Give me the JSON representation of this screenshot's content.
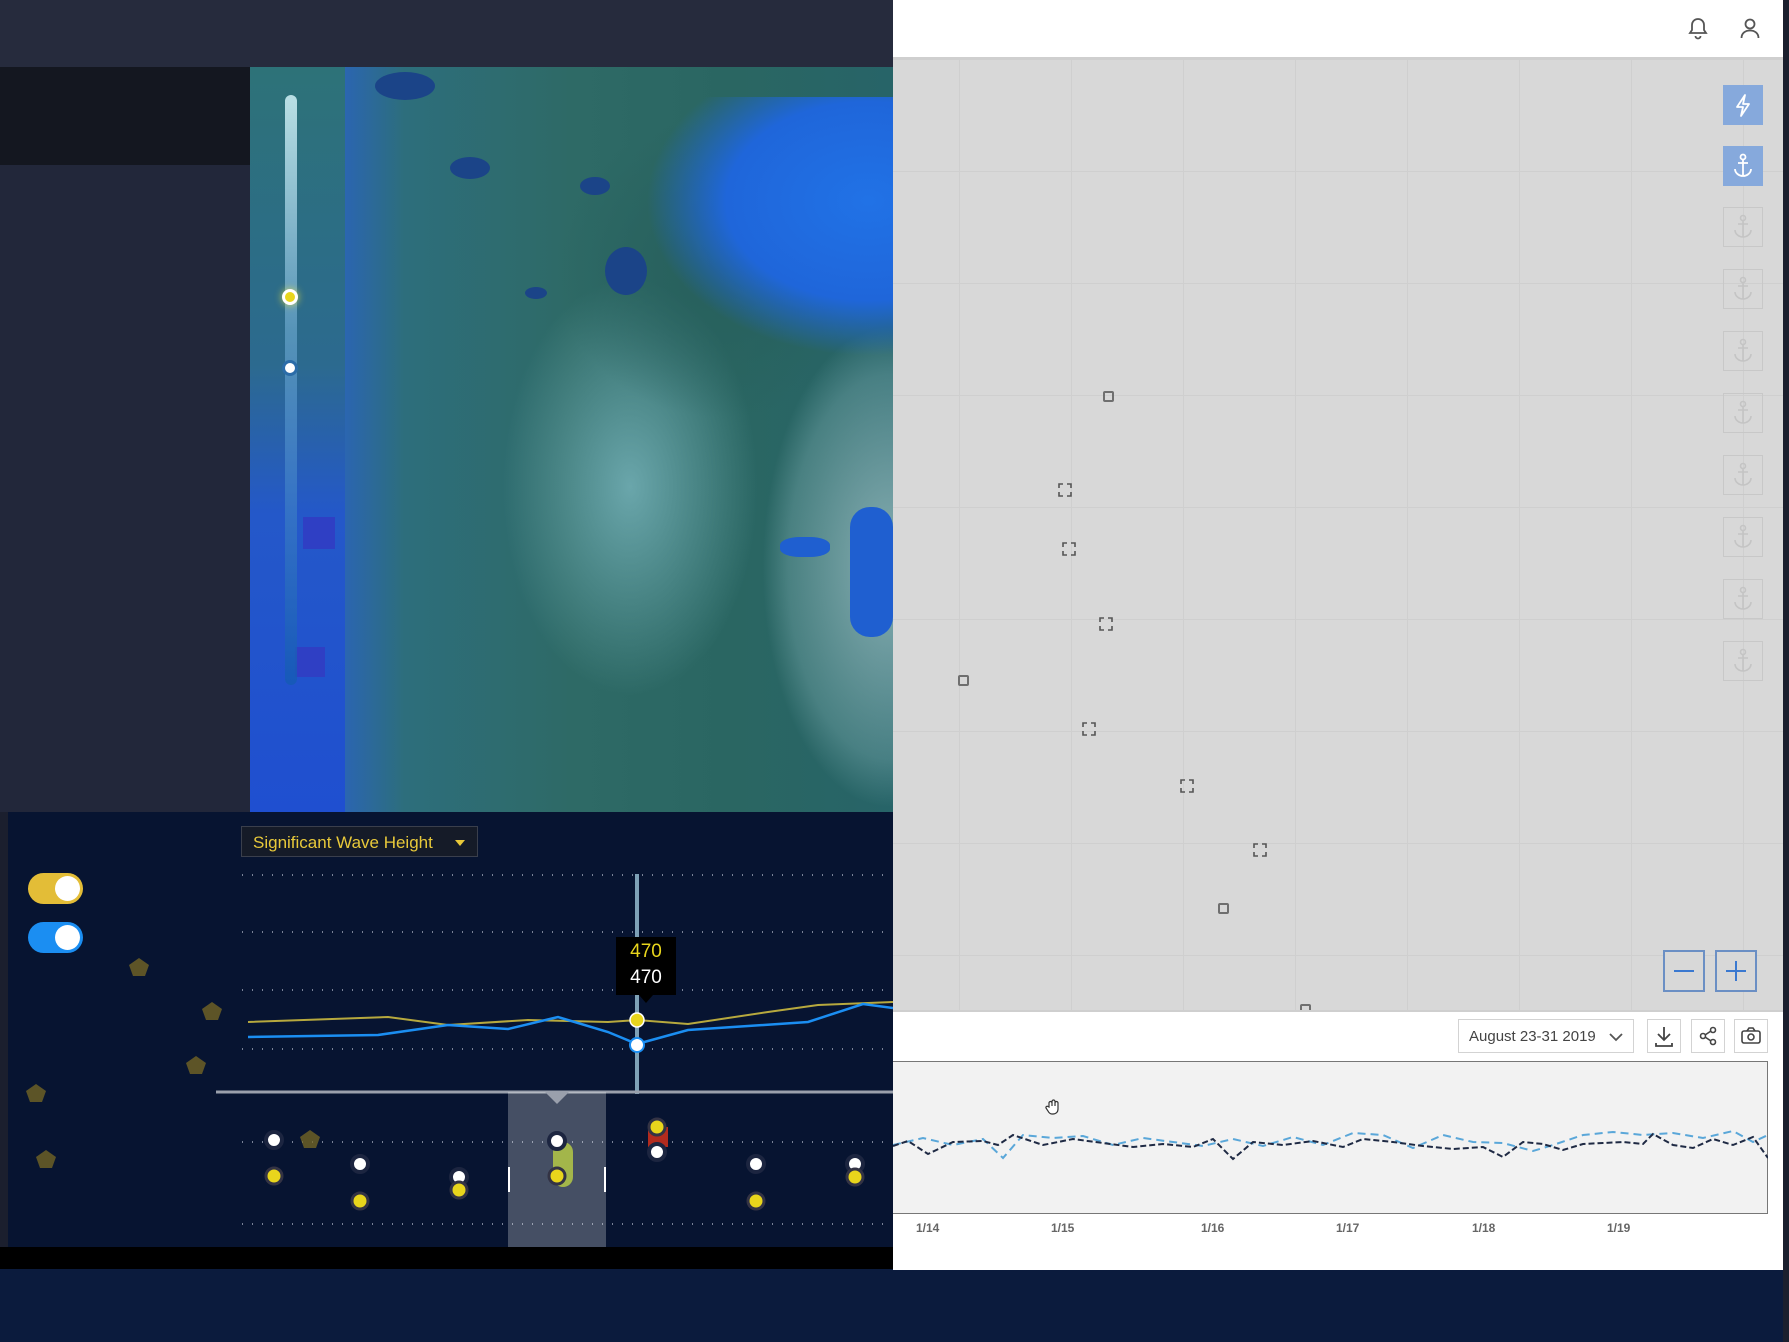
{
  "colors": {
    "accent_yellow": "#e8c93a",
    "accent_blue": "#1b8ef2",
    "panel_dark": "#071431",
    "right_bg": "#d8d8d8",
    "button_active": "#86a9dc"
  },
  "left_chart": {
    "metric_label": "Significant Wave Height",
    "tooltip_values": [
      "470",
      "470"
    ]
  },
  "right_app": {
    "header_icons": [
      "bell-icon",
      "user-icon"
    ],
    "side_buttons": [
      {
        "icon": "lightning-icon",
        "active": true
      },
      {
        "icon": "anchor-icon",
        "active": true
      },
      {
        "icon": "anchor-icon",
        "active": false
      },
      {
        "icon": "anchor-icon",
        "active": false
      },
      {
        "icon": "anchor-icon",
        "active": false
      },
      {
        "icon": "anchor-icon",
        "active": false
      },
      {
        "icon": "anchor-icon",
        "active": false
      },
      {
        "icon": "anchor-icon",
        "active": false
      },
      {
        "icon": "anchor-icon",
        "active": false
      },
      {
        "icon": "anchor-icon",
        "active": false
      }
    ],
    "date_range": "August 23-31 2019",
    "toolbar_icons": [
      "download-icon",
      "share-icon",
      "camera-icon"
    ],
    "x_ticks": [
      "1/14",
      "1/15",
      "1/16",
      "1/17",
      "1/18",
      "1/19"
    ]
  }
}
